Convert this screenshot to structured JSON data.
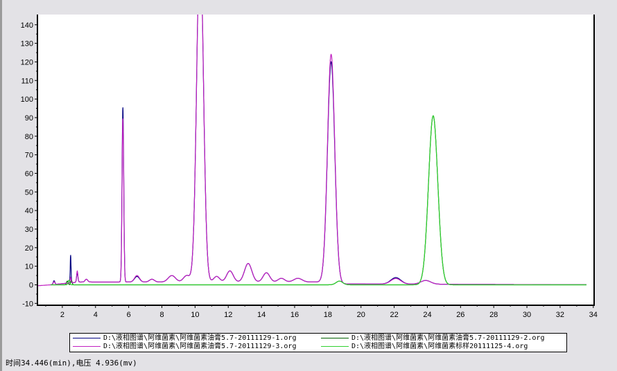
{
  "chart_data": {
    "type": "line",
    "title": "",
    "xlabel": "",
    "ylabel": "",
    "xlim": [
      0.5,
      34.05
    ],
    "ylim": [
      -11,
      145.5
    ],
    "xticks": [
      2,
      4,
      6,
      8,
      10,
      12,
      14,
      16,
      18,
      20,
      22,
      24,
      26,
      28,
      30,
      32,
      34
    ],
    "yticks": [
      -10,
      0,
      10,
      20,
      30,
      40,
      50,
      60,
      70,
      80,
      90,
      100,
      110,
      120,
      130,
      140
    ],
    "grid": false,
    "legend_position": "bottom",
    "series": [
      {
        "name": "D:\\液相图谱\\阿维菌素\\阿维菌素油膏5.7-20111129-1.org",
        "color": "#000080",
        "xrange": [
          1.3,
          33.6
        ],
        "baseline": [
          [
            1.3,
            0
          ],
          [
            3,
            1.5
          ],
          [
            5.5,
            1.5
          ],
          [
            17.5,
            1.5
          ],
          [
            19,
            0.5
          ],
          [
            34,
            0
          ]
        ],
        "peaks": [
          [
            1.5,
            2,
            0.05
          ],
          [
            2.5,
            15,
            0.025
          ],
          [
            2.9,
            5,
            0.04
          ],
          [
            3.45,
            1.5,
            0.08
          ],
          [
            5.65,
            94,
            0.05
          ],
          [
            6.5,
            3,
            0.15
          ],
          [
            7.4,
            1.5,
            0.15
          ],
          [
            8.6,
            3.5,
            0.22
          ],
          [
            9.5,
            3.5,
            0.2
          ],
          [
            10.3,
            185,
            0.2
          ],
          [
            11.3,
            3,
            0.18
          ],
          [
            12.1,
            6,
            0.2
          ],
          [
            13.2,
            10,
            0.22
          ],
          [
            14.3,
            5,
            0.2
          ],
          [
            15.2,
            2,
            0.2
          ],
          [
            16.2,
            2,
            0.25
          ],
          [
            18.2,
            119,
            0.22
          ],
          [
            22.1,
            3.5,
            0.3
          ],
          [
            23.9,
            2,
            0.3
          ]
        ]
      },
      {
        "name": "D:\\液相图谱\\阿维菌素\\阿维菌素油膏5.7-20111129-2.org",
        "color": "#006000",
        "xrange": [
          1.3,
          33.6
        ],
        "baseline": [
          [
            1.3,
            0
          ],
          [
            34,
            0
          ]
        ],
        "peaks": [
          [
            2.3,
            2,
            0.05
          ],
          [
            2.55,
            2.5,
            0.04
          ],
          [
            18.7,
            2,
            0.2
          ],
          [
            24.35,
            91,
            0.28
          ]
        ]
      },
      {
        "name": "D:\\液相图谱\\阿维菌素\\阿维菌素油膏5.7-20111129-3.org",
        "color": "#c020c0",
        "xrange": [
          0.5,
          33.6
        ],
        "baseline": [
          [
            0.5,
            -0.5
          ],
          [
            1.3,
            0
          ],
          [
            3,
            1.5
          ],
          [
            5.5,
            1.5
          ],
          [
            17.5,
            1.5
          ],
          [
            19,
            0.5
          ],
          [
            34,
            0
          ]
        ],
        "peaks": [
          [
            1.5,
            1.5,
            0.05
          ],
          [
            2.5,
            3,
            0.03
          ],
          [
            2.9,
            6,
            0.04
          ],
          [
            3.45,
            1.5,
            0.08
          ],
          [
            5.65,
            88,
            0.05
          ],
          [
            6.5,
            3.5,
            0.15
          ],
          [
            7.4,
            1.5,
            0.15
          ],
          [
            8.6,
            3.5,
            0.22
          ],
          [
            9.5,
            3.5,
            0.2
          ],
          [
            10.3,
            185,
            0.2
          ],
          [
            11.3,
            3,
            0.18
          ],
          [
            12.1,
            6,
            0.2
          ],
          [
            13.2,
            10,
            0.22
          ],
          [
            14.3,
            5,
            0.2
          ],
          [
            15.2,
            2,
            0.2
          ],
          [
            16.2,
            2,
            0.25
          ],
          [
            18.2,
            123,
            0.22
          ],
          [
            22.1,
            3,
            0.3
          ],
          [
            23.9,
            2,
            0.3
          ]
        ]
      },
      {
        "name": "D:\\液相图谱\\阿维菌素\\阿维菌素标样20111125-4.org",
        "color": "#30d030",
        "xrange": [
          1.3,
          33.6
        ],
        "baseline": [
          [
            1.3,
            0
          ],
          [
            34,
            0
          ]
        ],
        "peaks": [
          [
            2.4,
            2.5,
            0.05
          ],
          [
            18.7,
            2,
            0.2
          ],
          [
            24.35,
            91,
            0.28
          ]
        ]
      }
    ]
  },
  "status": "时间34.446(min),电压 4.936(mv)"
}
